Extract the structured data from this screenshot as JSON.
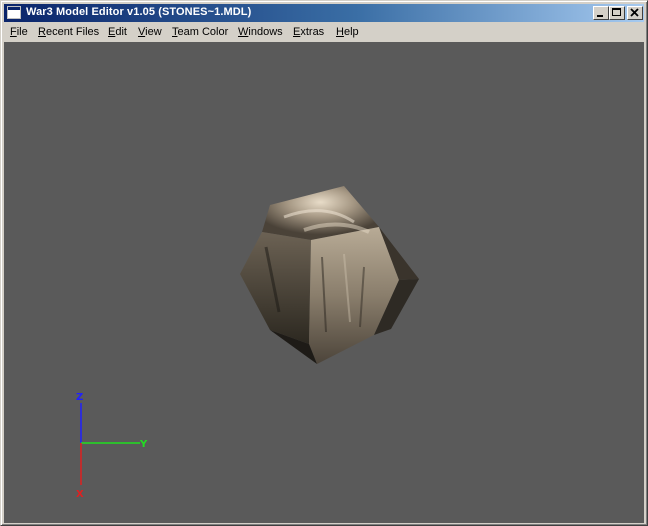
{
  "window": {
    "title": "War3 Model Editor v1.05 (STONES~1.MDL)"
  },
  "titlebar_buttons": {
    "minimize": "minimize",
    "maximize": "maximize",
    "close": "close"
  },
  "menu": {
    "items": [
      {
        "label": "File",
        "mnemonic": "F",
        "rest": "ile"
      },
      {
        "label": "Recent Files",
        "mnemonic": "R",
        "rest": "ecent Files"
      },
      {
        "label": "Edit",
        "mnemonic": "E",
        "rest": "dit"
      },
      {
        "label": "View",
        "mnemonic": "V",
        "rest": "iew"
      },
      {
        "label": "Team Color",
        "mnemonic": "T",
        "rest": "eam Color"
      },
      {
        "label": "Windows",
        "mnemonic": "W",
        "rest": "indows"
      },
      {
        "label": "Extras",
        "mnemonic": "E",
        "rest": "xtras"
      },
      {
        "label": "Help",
        "mnemonic": "H",
        "rest": "elp"
      }
    ]
  },
  "viewport": {
    "background_color": "#5a5a5a",
    "axes": {
      "z": {
        "label": "Z",
        "color": "#2020ff"
      },
      "y": {
        "label": "Y",
        "color": "#20e020"
      },
      "x": {
        "label": "X",
        "color": "#e02020"
      }
    },
    "model": "stone"
  }
}
